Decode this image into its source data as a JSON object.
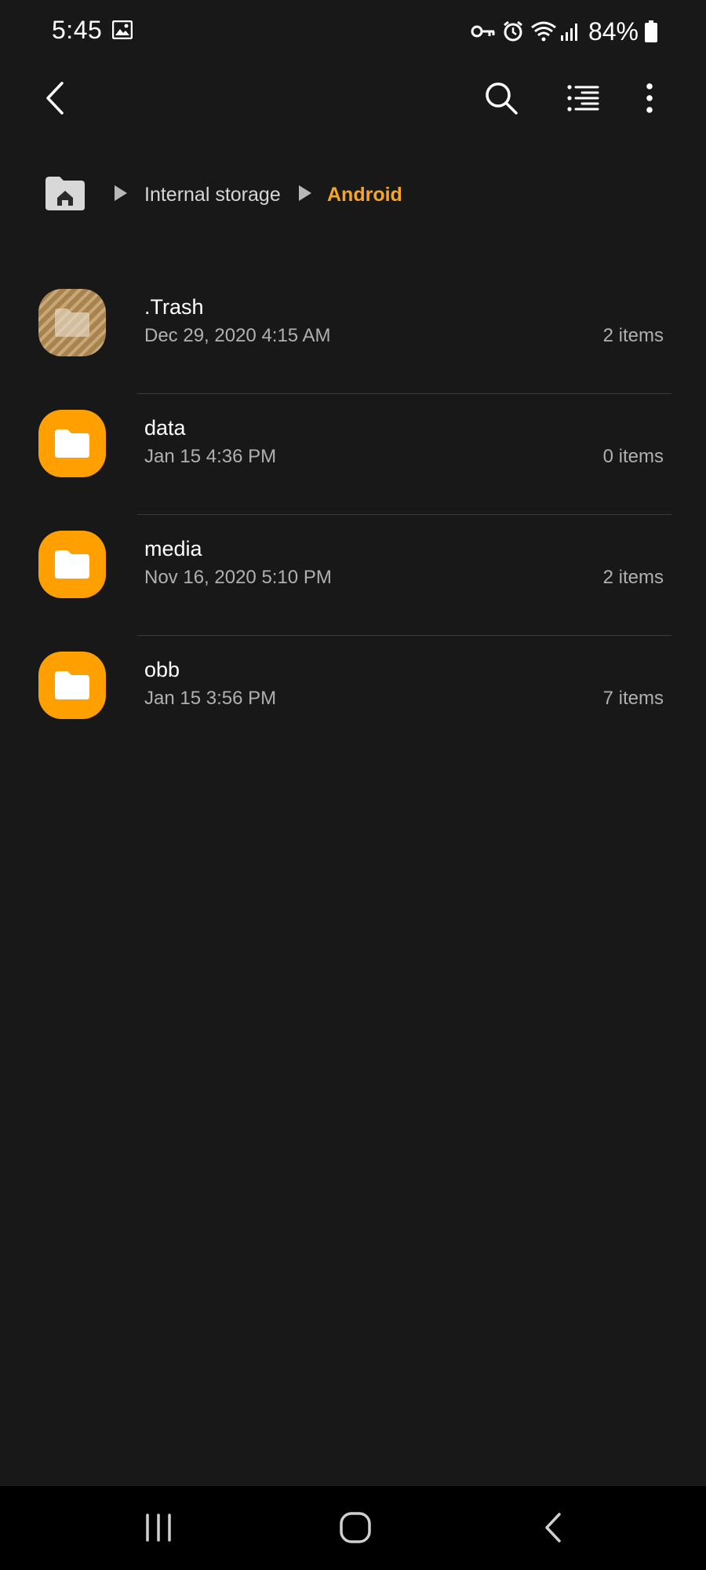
{
  "status_bar": {
    "time": "5:45",
    "battery_percent": "84%",
    "icons": [
      "gallery-icon",
      "vpn-key-icon",
      "alarm-icon",
      "wifi-icon",
      "signal-icon",
      "battery-icon"
    ]
  },
  "app_bar": {
    "icons": [
      "back-arrow-icon",
      "search-icon",
      "list-view-icon",
      "more-options-icon"
    ]
  },
  "breadcrumb": {
    "items": [
      "Internal storage",
      "Android"
    ],
    "accent_color": "#f6a623"
  },
  "files": [
    {
      "name": ".Trash",
      "date": "Dec 29, 2020 4:15 AM",
      "count": "2 items",
      "type": "trash-folder"
    },
    {
      "name": "data",
      "date": "Jan 15 4:36 PM",
      "count": "0 items",
      "type": "folder"
    },
    {
      "name": "media",
      "date": "Nov 16, 2020 5:10 PM",
      "count": "2 items",
      "type": "folder"
    },
    {
      "name": "obb",
      "date": "Jan 15 3:56 PM",
      "count": "7 items",
      "type": "folder"
    }
  ],
  "colors": {
    "background": "#181818",
    "folder": "#ffa000",
    "nav_bar": "#000000"
  },
  "nav_bar": {
    "icons": [
      "recent-apps-icon",
      "home-icon",
      "back-icon"
    ]
  }
}
